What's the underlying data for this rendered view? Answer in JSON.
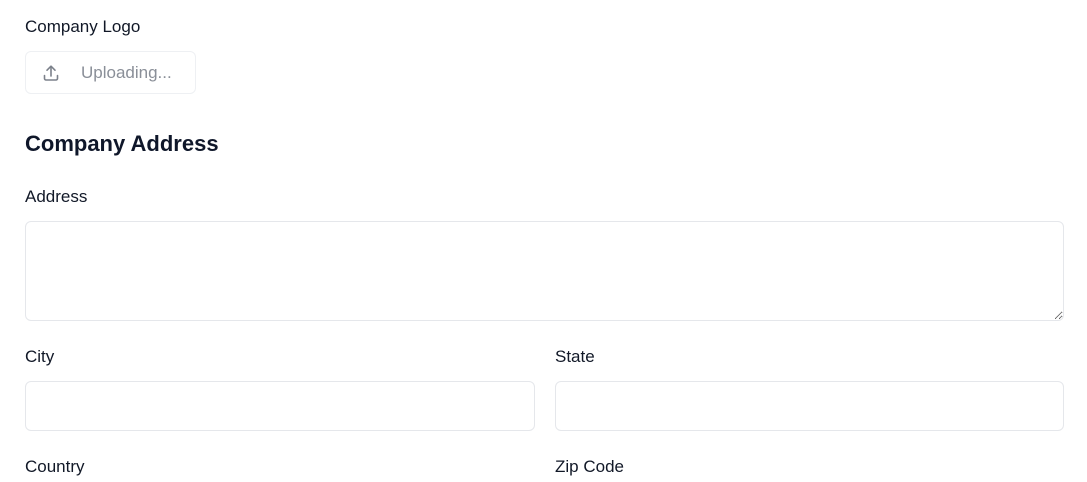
{
  "logo_section": {
    "label": "Company Logo",
    "upload_button_text": "Uploading...",
    "upload_icon": "upload-icon"
  },
  "address_section": {
    "heading": "Company Address",
    "address": {
      "label": "Address",
      "value": "",
      "placeholder": ""
    },
    "city": {
      "label": "City",
      "value": "",
      "placeholder": ""
    },
    "state": {
      "label": "State",
      "value": "",
      "placeholder": ""
    },
    "country": {
      "label": "Country"
    },
    "zip_code": {
      "label": "Zip Code"
    }
  },
  "colors": {
    "text": "#111827",
    "muted_text": "#8a8f98",
    "border": "#e5e7eb"
  }
}
